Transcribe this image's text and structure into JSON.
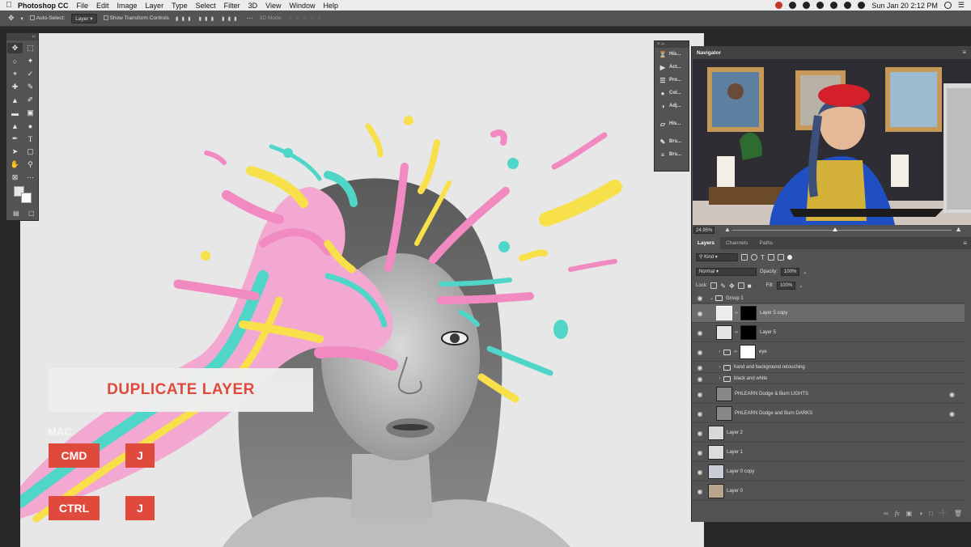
{
  "menubar": {
    "app_name": "Photoshop CC",
    "items": [
      "File",
      "Edit",
      "Image",
      "Layer",
      "Type",
      "Select",
      "Filter",
      "3D",
      "View",
      "Window",
      "Help"
    ],
    "clock": "Sun Jan 20  2:12 PM"
  },
  "options_bar": {
    "auto_select_label": "Auto-Select:",
    "auto_select_value": "Layer",
    "transform_controls_label": "Show Transform Controls",
    "mode_3d_label": "3D Mode:"
  },
  "mini_panel": {
    "items": [
      {
        "label": "His...",
        "icon": "history-icon"
      },
      {
        "label": "Act...",
        "icon": "actions-icon"
      },
      {
        "label": "Pro...",
        "icon": "properties-icon"
      },
      {
        "label": "Col...",
        "icon": "color-icon"
      },
      {
        "label": "Adj...",
        "icon": "adjustments-icon"
      },
      {
        "label": "His...",
        "icon": "histogram-icon"
      },
      {
        "label": "Bru...",
        "icon": "brush-icon"
      },
      {
        "label": "Bru...",
        "icon": "brush-settings-icon"
      }
    ]
  },
  "navigator": {
    "title": "Navigator",
    "zoom": "24.95%"
  },
  "layers_panel": {
    "tabs": [
      "Layers",
      "Channels",
      "Paths"
    ],
    "active_tab": "Layers",
    "filter_kind": "Kind",
    "blend_mode": "Normal",
    "opacity_label": "Opacity:",
    "opacity_value": "100%",
    "lock_label": "Lock:",
    "fill_label": "Fill:",
    "fill_value": "100%",
    "layers": [
      {
        "name": "Group 1",
        "type": "group",
        "expanded": true,
        "indent": 0
      },
      {
        "name": "Layer 5 copy",
        "type": "masked",
        "selected": true,
        "indent": 1
      },
      {
        "name": "Layer 5",
        "type": "masked",
        "indent": 1
      },
      {
        "name": "eye",
        "type": "group-masked",
        "indent": 1
      },
      {
        "name": "hand and background retouching",
        "type": "group",
        "indent": 1
      },
      {
        "name": "black and white",
        "type": "group",
        "indent": 1
      },
      {
        "name": "PHLEARN Dodge & Burn LIGHTS",
        "type": "smart",
        "indent": 1
      },
      {
        "name": "PHLEARN Dodge and Burn DARKS",
        "type": "smart",
        "indent": 1
      },
      {
        "name": "Layer 2",
        "type": "pixel",
        "indent": 0
      },
      {
        "name": "Layer 1",
        "type": "pixel",
        "indent": 0
      },
      {
        "name": "Layer 0 copy",
        "type": "pixel",
        "indent": 0
      },
      {
        "name": "Layer 0",
        "type": "pixel",
        "indent": 0
      }
    ]
  },
  "overlay": {
    "title": "DUPLICATE LAYER",
    "mac_label": "MAC",
    "mac_key1": "CMD",
    "mac_key2": "J",
    "win_key1": "CTRL",
    "win_key2": "J"
  },
  "colors": {
    "accent": "#e04a3c",
    "panel": "#535353",
    "canvas_bg": "#e6e6e6"
  }
}
